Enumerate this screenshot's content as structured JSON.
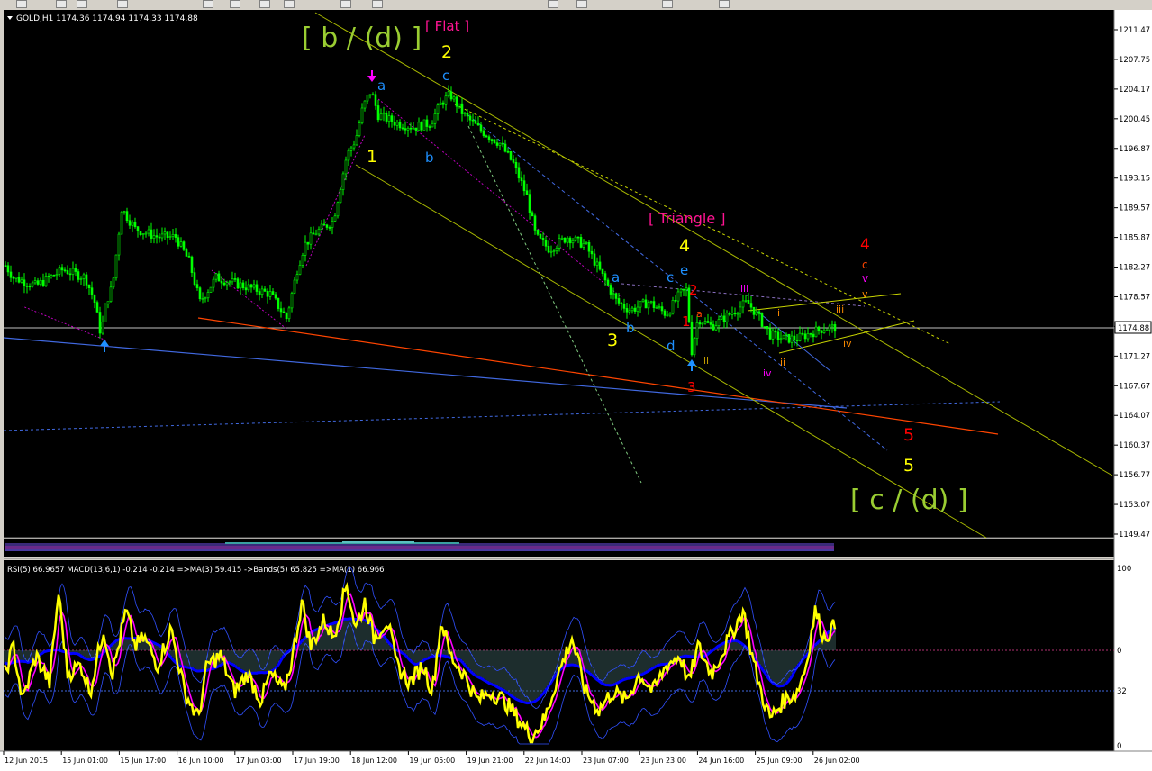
{
  "header": {
    "symbol_line": "GOLD,H1  1174.36 1174.94 1174.33 1174.88"
  },
  "price_axis": {
    "ticks": [
      "1211.47",
      "1207.75",
      "1204.17",
      "1200.45",
      "1196.87",
      "1193.15",
      "1189.57",
      "1185.87",
      "1182.27",
      "1178.57",
      "1174.88",
      "1171.27",
      "1167.67",
      "1164.07",
      "1160.37",
      "1156.77",
      "1153.07",
      "1149.47"
    ],
    "current_price": "1174.88"
  },
  "indicator_panel": {
    "label": "RSI(5) 66.9657  MACD(13,6,1) -0.214 -0.214  =>MA(3) 59.415  ->Bands(5) 65.825  =>MA(1) 66.966",
    "axis_ticks": [
      "100",
      "0",
      "32",
      "0"
    ]
  },
  "time_axis": {
    "labels": [
      "12 Jun 2015",
      "15 Jun 01:00",
      "15 Jun 17:00",
      "16 Jun 10:00",
      "17 Jun 03:00",
      "17 Jun 19:00",
      "18 Jun 12:00",
      "19 Jun 05:00",
      "19 Jun 21:00",
      "22 Jun 14:00",
      "23 Jun 07:00",
      "23 Jun 23:00",
      "24 Jun 16:00",
      "25 Jun 09:00",
      "26 Jun 02:00"
    ]
  },
  "annotations": {
    "b_d": "[ b / (d) ]",
    "flat": "[ Flat ]",
    "w2": "2",
    "c_top": "c",
    "a_top": "a",
    "w1": "1",
    "b_low": "b",
    "triangle": "[ Triangle ]",
    "w4_yellow": "4",
    "tri_a": "a",
    "tri_c": "c",
    "tri_e": "e",
    "tri_b": "b",
    "tri_d": "d",
    "w3_yellow": "3",
    "w2_red": "2",
    "w1_red": "1",
    "w3_red": "3",
    "sub_a": "a",
    "sub_ii": "ii",
    "sub_iii": "iii",
    "sub_i": "i",
    "sub_iv": "iv",
    "sub_ii2": "ii",
    "sub_iii2": "iii",
    "sub_iv2": "iv",
    "w4_red": "4",
    "c_red": "c",
    "v_pink": "v",
    "v_orange": "v",
    "w5_red": "5",
    "w5_yellow": "5",
    "c_d": "[ c / (d) ]"
  },
  "colors": {
    "background": "#000000",
    "bull_candle": "#00ff00",
    "grid_line": "#c0c0c0",
    "channel_line": "#a8b800",
    "wave_label_green": "#9acd32",
    "wave_label_yellow": "#ffff00",
    "wave_label_cyan": "#1e90ff",
    "wave_label_red": "#ff0000",
    "wave_label_pink": "#ff1493",
    "rsi_line": "#ffff00",
    "ma_line": "#ff00ff",
    "bands_line": "#0000ff",
    "macd_hist": "#2f4f4f",
    "trend_line_blue": "#4169e1",
    "trend_line_red": "#ff4500"
  },
  "chart_data": {
    "type": "candlestick",
    "symbol": "GOLD",
    "timeframe": "H1",
    "ylim": [
      1149.47,
      1211.47
    ],
    "x_labels": [
      "12 Jun 2015",
      "15 Jun 01:00",
      "15 Jun 17:00",
      "16 Jun 10:00",
      "17 Jun 03:00",
      "17 Jun 19:00",
      "18 Jun 12:00",
      "19 Jun 05:00",
      "19 Jun 21:00",
      "22 Jun 14:00",
      "23 Jun 07:00",
      "23 Jun 23:00",
      "24 Jun 16:00",
      "25 Jun 09:00",
      "26 Jun 02:00"
    ],
    "path": [
      [
        0,
        1183.5
      ],
      [
        15,
        1181
      ],
      [
        40,
        1180
      ],
      [
        70,
        1182
      ],
      [
        95,
        1181
      ],
      [
        105,
        1178
      ],
      [
        112,
        1174
      ],
      [
        118,
        1178
      ],
      [
        125,
        1180
      ],
      [
        135,
        1189.5
      ],
      [
        150,
        1187
      ],
      [
        175,
        1186
      ],
      [
        195,
        1186
      ],
      [
        210,
        1183
      ],
      [
        222,
        1178
      ],
      [
        240,
        1181
      ],
      [
        270,
        1180
      ],
      [
        300,
        1179
      ],
      [
        318,
        1176
      ],
      [
        330,
        1182
      ],
      [
        338,
        1185
      ],
      [
        350,
        1186.5
      ],
      [
        370,
        1188
      ],
      [
        385,
        1196
      ],
      [
        395,
        1198
      ],
      [
        403,
        1202
      ],
      [
        412,
        1204
      ],
      [
        420,
        1201
      ],
      [
        440,
        1200
      ],
      [
        460,
        1199.5
      ],
      [
        478,
        1200
      ],
      [
        490,
        1202.5
      ],
      [
        500,
        1203.5
      ],
      [
        515,
        1201
      ],
      [
        535,
        1199
      ],
      [
        555,
        1197.5
      ],
      [
        570,
        1195
      ],
      [
        585,
        1191
      ],
      [
        595,
        1186
      ],
      [
        610,
        1184.5
      ],
      [
        630,
        1186
      ],
      [
        650,
        1185
      ],
      [
        665,
        1182
      ],
      [
        685,
        1178
      ],
      [
        700,
        1177
      ],
      [
        720,
        1178
      ],
      [
        740,
        1176.5
      ],
      [
        755,
        1179
      ],
      [
        762,
        1179.5
      ],
      [
        768,
        1172
      ],
      [
        775,
        1176
      ],
      [
        790,
        1175
      ],
      [
        810,
        1176.5
      ],
      [
        830,
        1178
      ],
      [
        840,
        1176.5
      ],
      [
        855,
        1174
      ],
      [
        870,
        1173.5
      ],
      [
        885,
        1173.5
      ],
      [
        900,
        1174.2
      ],
      [
        915,
        1174.8
      ],
      [
        928,
        1174.88
      ]
    ],
    "rsi_current": 66.9657,
    "macd": [
      -0.214,
      -0.214
    ],
    "ma3": 59.415,
    "bands5": 65.825,
    "ma1": 66.966,
    "rsi_path": [
      [
        5,
        40
      ],
      [
        15,
        55
      ],
      [
        25,
        25
      ],
      [
        40,
        50
      ],
      [
        55,
        35
      ],
      [
        65,
        85
      ],
      [
        75,
        40
      ],
      [
        90,
        45
      ],
      [
        100,
        30
      ],
      [
        115,
        65
      ],
      [
        125,
        40
      ],
      [
        140,
        75
      ],
      [
        150,
        55
      ],
      [
        160,
        60
      ],
      [
        175,
        45
      ],
      [
        190,
        65
      ],
      [
        205,
        30
      ],
      [
        220,
        15
      ],
      [
        230,
        45
      ],
      [
        245,
        50
      ],
      [
        260,
        30
      ],
      [
        275,
        40
      ],
      [
        290,
        25
      ],
      [
        300,
        40
      ],
      [
        315,
        30
      ],
      [
        325,
        50
      ],
      [
        335,
        80
      ],
      [
        345,
        55
      ],
      [
        360,
        70
      ],
      [
        370,
        60
      ],
      [
        385,
        90
      ],
      [
        395,
        65
      ],
      [
        405,
        80
      ],
      [
        415,
        60
      ],
      [
        430,
        70
      ],
      [
        440,
        45
      ],
      [
        455,
        35
      ],
      [
        470,
        45
      ],
      [
        480,
        30
      ],
      [
        490,
        70
      ],
      [
        500,
        50
      ],
      [
        515,
        40
      ],
      [
        530,
        25
      ],
      [
        545,
        30
      ],
      [
        560,
        25
      ],
      [
        575,
        15
      ],
      [
        590,
        5
      ],
      [
        605,
        15
      ],
      [
        620,
        40
      ],
      [
        635,
        60
      ],
      [
        650,
        30
      ],
      [
        665,
        20
      ],
      [
        680,
        30
      ],
      [
        695,
        25
      ],
      [
        710,
        40
      ],
      [
        725,
        30
      ],
      [
        740,
        45
      ],
      [
        755,
        50
      ],
      [
        765,
        35
      ],
      [
        775,
        55
      ],
      [
        790,
        40
      ],
      [
        805,
        55
      ],
      [
        815,
        65
      ],
      [
        825,
        75
      ],
      [
        835,
        50
      ],
      [
        845,
        30
      ],
      [
        855,
        15
      ],
      [
        870,
        25
      ],
      [
        885,
        30
      ],
      [
        895,
        45
      ],
      [
        905,
        75
      ],
      [
        915,
        60
      ],
      [
        928,
        67
      ]
    ]
  }
}
